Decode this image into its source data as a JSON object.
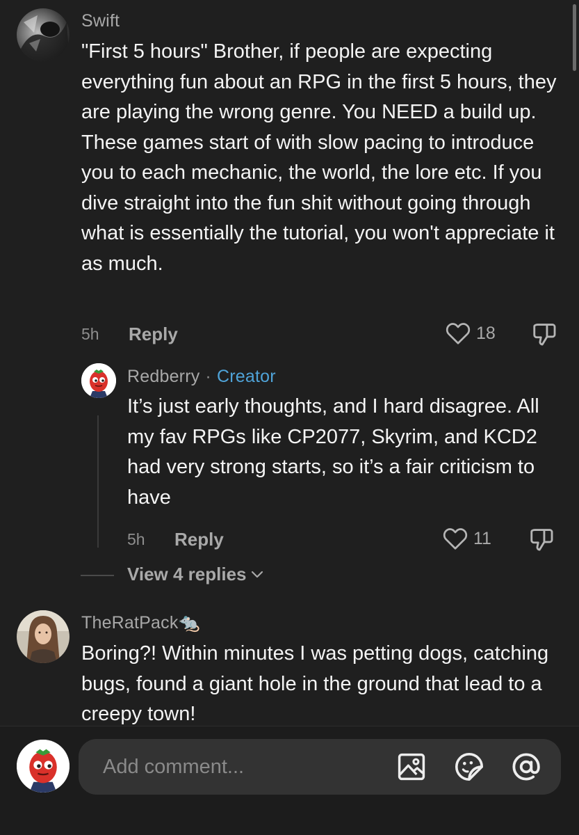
{
  "comments": [
    {
      "username": "Swift",
      "text": "\"First 5 hours\" Brother, if people are expecting everything fun about an RPG in the first 5 hours, they are playing the wrong genre. You NEED a build up. These games start of with slow pacing to introduce you to each mechanic, the world, the lore etc. If you dive straight into the fun shit without going through what is essentially the tutorial, you won't appreciate it as much.",
      "time": "5h",
      "reply_label": "Reply",
      "likes": "18"
    },
    {
      "username": "Redberry",
      "badge": "Creator",
      "separator": "·",
      "text": "It’s just early thoughts, and I hard disagree. All my fav RPGs like CP2077, Skyrim, and KCD2 had very strong starts, so it’s a fair criticism to have",
      "time": "5h",
      "reply_label": "Reply",
      "likes": "11"
    },
    {
      "username": "TheRatPack🐀",
      "text": "Boring?! Within minutes I was petting dogs, catching bugs, found a giant hole in the ground that lead to a creepy town!"
    }
  ],
  "view_replies_label": "View 4 replies",
  "composer": {
    "placeholder": "Add comment..."
  },
  "icons": {
    "like": "heart-outline-icon",
    "dislike": "thumbs-down-icon",
    "image": "image-icon",
    "sticker": "sticker-icon",
    "mention": "at-icon"
  },
  "colors": {
    "background": "#1f1f1f",
    "creator_badge": "#4fa3d8",
    "input_bg": "#333333"
  }
}
